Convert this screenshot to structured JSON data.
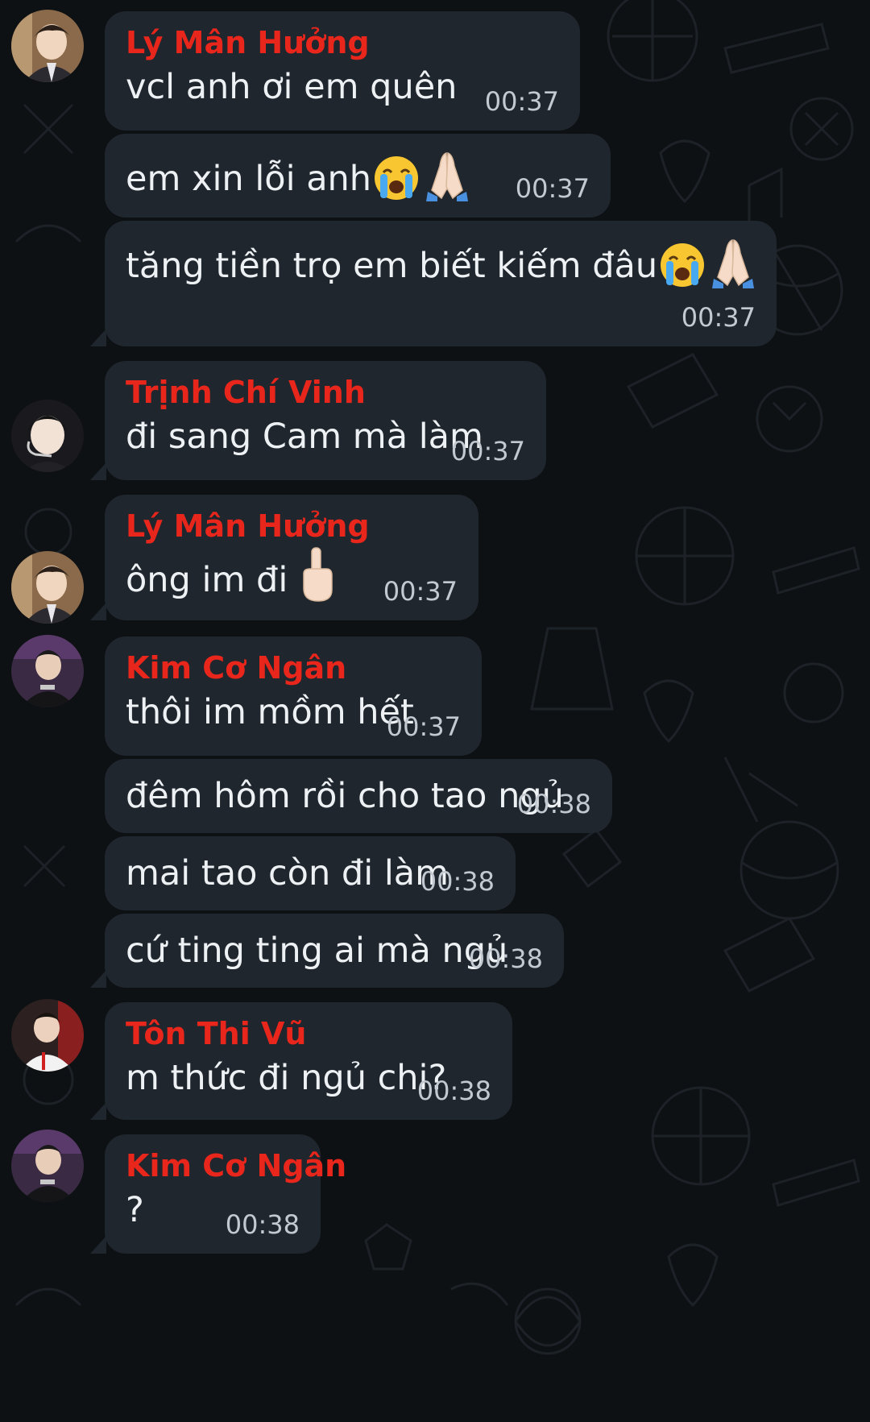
{
  "messages": [
    {
      "sender": "Lý Mân Hưởng",
      "text": "vcl anh ơi em quên",
      "time": "00:37"
    },
    {
      "sender": "",
      "text": "em xin lỗi anh",
      "emojis": [
        "crying-face",
        "folded-hands"
      ],
      "time": "00:37"
    },
    {
      "sender": "",
      "text": "tăng tiền trọ em biết kiếm đâu",
      "emojis": [
        "crying-face",
        "folded-hands"
      ],
      "time": "00:37"
    },
    {
      "sender": "Trịnh Chí Vinh",
      "text": "đi sang Cam mà làm",
      "time": "00:37"
    },
    {
      "sender": "Lý Mân Hưởng",
      "text": "ông im đi",
      "emojis": [
        "middle-finger"
      ],
      "time": "00:37"
    },
    {
      "sender": "Kim Cơ Ngân",
      "text": "thôi im mồm hết",
      "time": "00:37"
    },
    {
      "sender": "",
      "text": "đêm hôm rồi cho tao ngủ",
      "time": "00:38"
    },
    {
      "sender": "",
      "text": "mai tao còn đi làm",
      "time": "00:38"
    },
    {
      "sender": "",
      "text": "cứ ting ting ai mà ngủ",
      "time": "00:38"
    },
    {
      "sender": "Tôn Thi Vũ",
      "text": "m thức đi ngủ chi?",
      "time": "00:38"
    },
    {
      "sender": "Kim Cơ Ngân",
      "text": "?",
      "time": "00:38"
    }
  ],
  "colors": {
    "background": "#0e1114",
    "bubble": "#1f262e",
    "sender_name": "#e8261b",
    "message_text": "#eef1f4",
    "timestamp": "#c3c9d0"
  }
}
